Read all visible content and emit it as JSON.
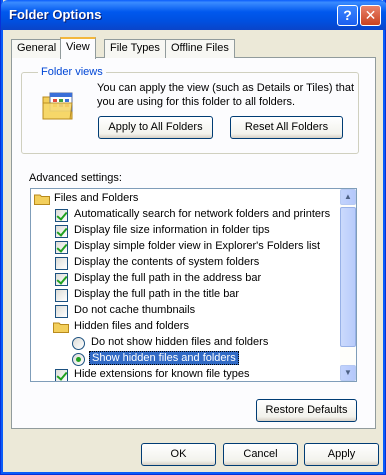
{
  "window": {
    "title": "Folder Options",
    "help_label": "?",
    "close_label": "✕"
  },
  "tabs": [
    {
      "label": "General"
    },
    {
      "label": "View"
    },
    {
      "label": "File Types"
    },
    {
      "label": "Offline Files"
    }
  ],
  "folder_views": {
    "legend": "Folder views",
    "description": "You can apply the view (such as Details or Tiles) that you are using for this folder to all folders.",
    "apply_all_label": "Apply to All Folders",
    "reset_all_label": "Reset All Folders"
  },
  "advanced": {
    "label": "Advanced settings:",
    "items": [
      {
        "type": "folder",
        "label": "Files and Folders"
      },
      {
        "type": "checkbox",
        "checked": true,
        "label": "Automatically search for network folders and printers"
      },
      {
        "type": "checkbox",
        "checked": true,
        "label": "Display file size information in folder tips"
      },
      {
        "type": "checkbox",
        "checked": true,
        "label": "Display simple folder view in Explorer's Folders list"
      },
      {
        "type": "checkbox",
        "checked": false,
        "label": "Display the contents of system folders"
      },
      {
        "type": "checkbox",
        "checked": true,
        "label": "Display the full path in the address bar"
      },
      {
        "type": "checkbox",
        "checked": false,
        "label": "Display the full path in the title bar"
      },
      {
        "type": "checkbox",
        "checked": false,
        "label": "Do not cache thumbnails"
      },
      {
        "type": "folder",
        "label": "Hidden files and folders"
      },
      {
        "type": "radio",
        "checked": false,
        "label": "Do not show hidden files and folders"
      },
      {
        "type": "radio",
        "checked": true,
        "label": "Show hidden files and folders",
        "selected": true
      },
      {
        "type": "checkbox",
        "checked": true,
        "label": "Hide extensions for known file types"
      }
    ],
    "restore_label": "Restore Defaults"
  },
  "footer": {
    "ok_label": "OK",
    "cancel_label": "Cancel",
    "apply_label": "Apply"
  },
  "colors": {
    "title_bar": "#0058ee",
    "selection": "#316ac5",
    "group_legend": "#0046d5"
  }
}
